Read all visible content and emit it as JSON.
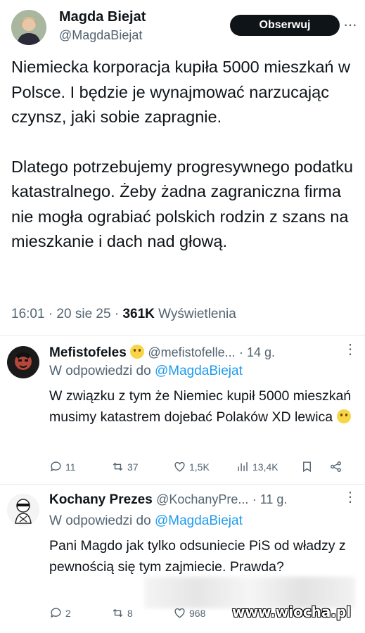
{
  "tweet": {
    "author_name": "Magda Biejat",
    "author_handle": "@MagdaBiejat",
    "follow_label": "Obserwuj",
    "more_label": "···",
    "paragraph_1": "Niemiecka korporacja kupiła 5000 mieszkań w Polsce. I będzie je wynajmować narzucając czynsz, jaki sobie zapragnie.",
    "paragraph_2": "Dlatego potrzebujemy progresywnego podatku katastralnego. Żeby żadna zagraniczna firma nie mogła ograbiać polskich rodzin z szans na mieszkanie i dach nad głową.",
    "time": "16:01 · 20 sie 25 · ",
    "views_count": "361K",
    "views_label": " Wyświetlenia"
  },
  "replies": [
    {
      "author_name": "Mefistofeles",
      "author_handle": "@mefistofelle...",
      "age": "· 14 g.",
      "in_reply_prefix": "W odpowiedzi do ",
      "in_reply_mention": "@MagdaBiejat",
      "text": "W związku z tym że Niemiec kupił 5000 mieszkań musimy katastrem dojebać Polaków XD lewica",
      "replies_count": "11",
      "retweets_count": "37",
      "likes_count": "1,5K",
      "views_count": "13,4K"
    },
    {
      "author_name": "Kochany Prezes",
      "author_handle": "@KochanyPre...",
      "age": "· 11 g.",
      "in_reply_prefix": "W odpowiedzi do ",
      "in_reply_mention": "@MagdaBiejat",
      "text": "Pani Magdo jak tylko odsuniecie PiS od władzy z pewnością się tym zajmiecie. Prawda?",
      "replies_count": "2",
      "retweets_count": "8",
      "likes_count": "968"
    }
  ],
  "watermark": "www.wiocha.pl",
  "colors": {
    "link": "#1d9bf0",
    "muted": "#536471",
    "text": "#0f1419",
    "button": "#0f1419"
  }
}
